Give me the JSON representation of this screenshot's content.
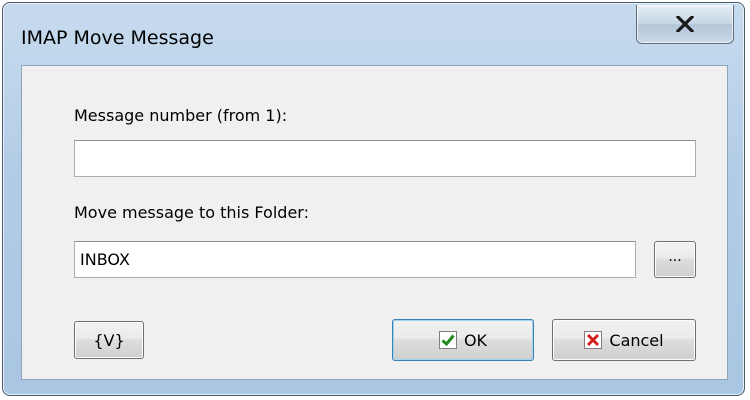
{
  "window": {
    "title": "IMAP Move Message",
    "close_glyph": "x"
  },
  "form": {
    "message_number": {
      "label": "Message number (from 1):",
      "value": ""
    },
    "folder": {
      "label": "Move message to this Folder:",
      "value": "INBOX",
      "browse_label": "..."
    }
  },
  "buttons": {
    "variables_label": "{V}",
    "ok_label": "OK",
    "cancel_label": "Cancel"
  },
  "colors": {
    "ok_check": "#1f8a1f",
    "cancel_x": "#d21f1f",
    "close_x": "#1a1a1a"
  },
  "icons": {
    "ok": "check-icon",
    "cancel": "cancel-x-icon",
    "close": "close-icon"
  }
}
